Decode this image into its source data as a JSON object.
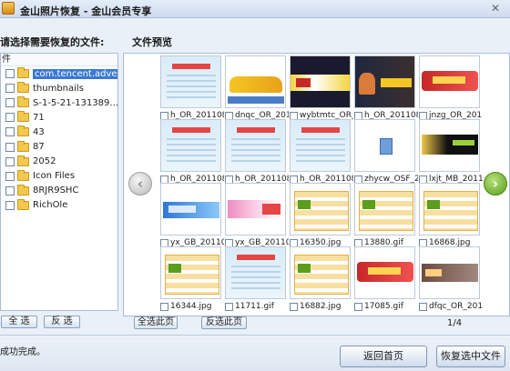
{
  "window": {
    "title": "金山照片恢复 - 金山会员专享",
    "close_glyph": "✕"
  },
  "left_panel": {
    "heading": "请选择需要恢复的文件:",
    "column_header": "件",
    "items": [
      {
        "label": "com.tencent.adve...",
        "selected": true
      },
      {
        "label": "thumbnails"
      },
      {
        "label": "S-1-5-21-131389..."
      },
      {
        "label": "71"
      },
      {
        "label": "43"
      },
      {
        "label": "87"
      },
      {
        "label": "2052"
      },
      {
        "label": "Icon Files"
      },
      {
        "label": "8RJR9SHC"
      },
      {
        "label": "RichOle"
      }
    ],
    "select_all": "全 选",
    "invert": "反 选"
  },
  "preview": {
    "heading": "文件预览",
    "select_page": "全选此页",
    "invert_page": "反选此页",
    "page_indicator": "1/4",
    "prev_glyph": "‹",
    "next_glyph": "›",
    "thumbnails": [
      {
        "caption": "h_OR_201108",
        "icon": "document-thumbnail"
      },
      {
        "caption": "dnqc_OR_2011",
        "icon": "car-banner-thumbnail"
      },
      {
        "caption": "wybtmtc_OR_2",
        "icon": "game-banner-thumbnail"
      },
      {
        "caption": "h_OR_201108",
        "icon": "hero-banner-thumbnail"
      },
      {
        "caption": "jnzg_OR_2011",
        "icon": "red-banner-thumbnail"
      },
      {
        "caption": "h_OR_201108",
        "icon": "document-thumbnail"
      },
      {
        "caption": "h_OR_201108",
        "icon": "document-thumbnail"
      },
      {
        "caption": "h_OR_201108",
        "icon": "document-thumbnail"
      },
      {
        "caption": "zhycw_OSF_20",
        "icon": "small-file-icon"
      },
      {
        "caption": "lxjt_MB_20110",
        "icon": "laptop-banner-thumbnail"
      },
      {
        "caption": "yx_GB_201108",
        "icon": "blue-banner-thumbnail"
      },
      {
        "caption": "yx_GB_201108",
        "icon": "promo-banner-thumbnail"
      },
      {
        "caption": "16350.jpg",
        "icon": "grid-ad-thumbnail"
      },
      {
        "caption": "13880.gif",
        "icon": "grid-ad-thumbnail"
      },
      {
        "caption": "16868.jpg",
        "icon": "grid-ad-thumbnail"
      },
      {
        "caption": "16344.jpg",
        "icon": "grid-ad-thumbnail"
      },
      {
        "caption": "11711.gif",
        "icon": "document-thumbnail"
      },
      {
        "caption": "16882.jpg",
        "icon": "grid-ad-thumbnail"
      },
      {
        "caption": "17085.gif",
        "icon": "red-banner-thumbnail"
      },
      {
        "caption": "dfqc_OR_2011",
        "icon": "brown-banner-thumbnail"
      }
    ]
  },
  "footer": {
    "status": "成功完成。",
    "back_button": "返回首页",
    "recover_button": "恢复选中文件"
  },
  "colors": {
    "accent": "#3a78d4",
    "next_arrow": "#5a9e1c",
    "frame_bg": "#e9f0f8"
  }
}
